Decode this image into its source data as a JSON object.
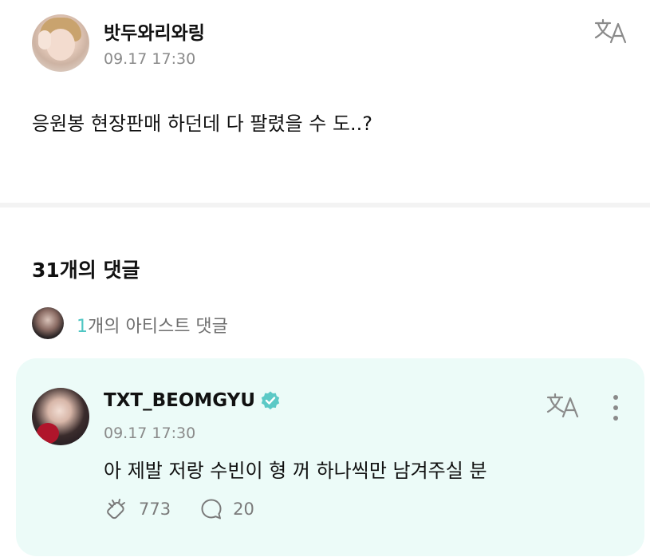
{
  "post": {
    "author": "밧두와리와링",
    "time": "09.17 17:30",
    "body": "응원봉 현장판매 하던데 다 팔렸을 수 도..?"
  },
  "comments_section": {
    "title": "31개의 댓글",
    "artist_comment_count": "1",
    "artist_comment_label": "개의 아티스트 댓글"
  },
  "comment": {
    "author": "TXT_BEOMGYU",
    "time": "09.17 17:30",
    "body": "아 제발 저랑 수빈이 형 꺼 하나씩만 남겨주실 분",
    "likes": "773",
    "replies": "20"
  },
  "colors": {
    "accent": "#4fc6c3",
    "comment_card_bg": "#ecfbf8",
    "verified": "#5cc9c6"
  },
  "icons": [
    "translate-icon",
    "verified-badge-icon",
    "more-icon",
    "like-icon",
    "reply-icon"
  ]
}
